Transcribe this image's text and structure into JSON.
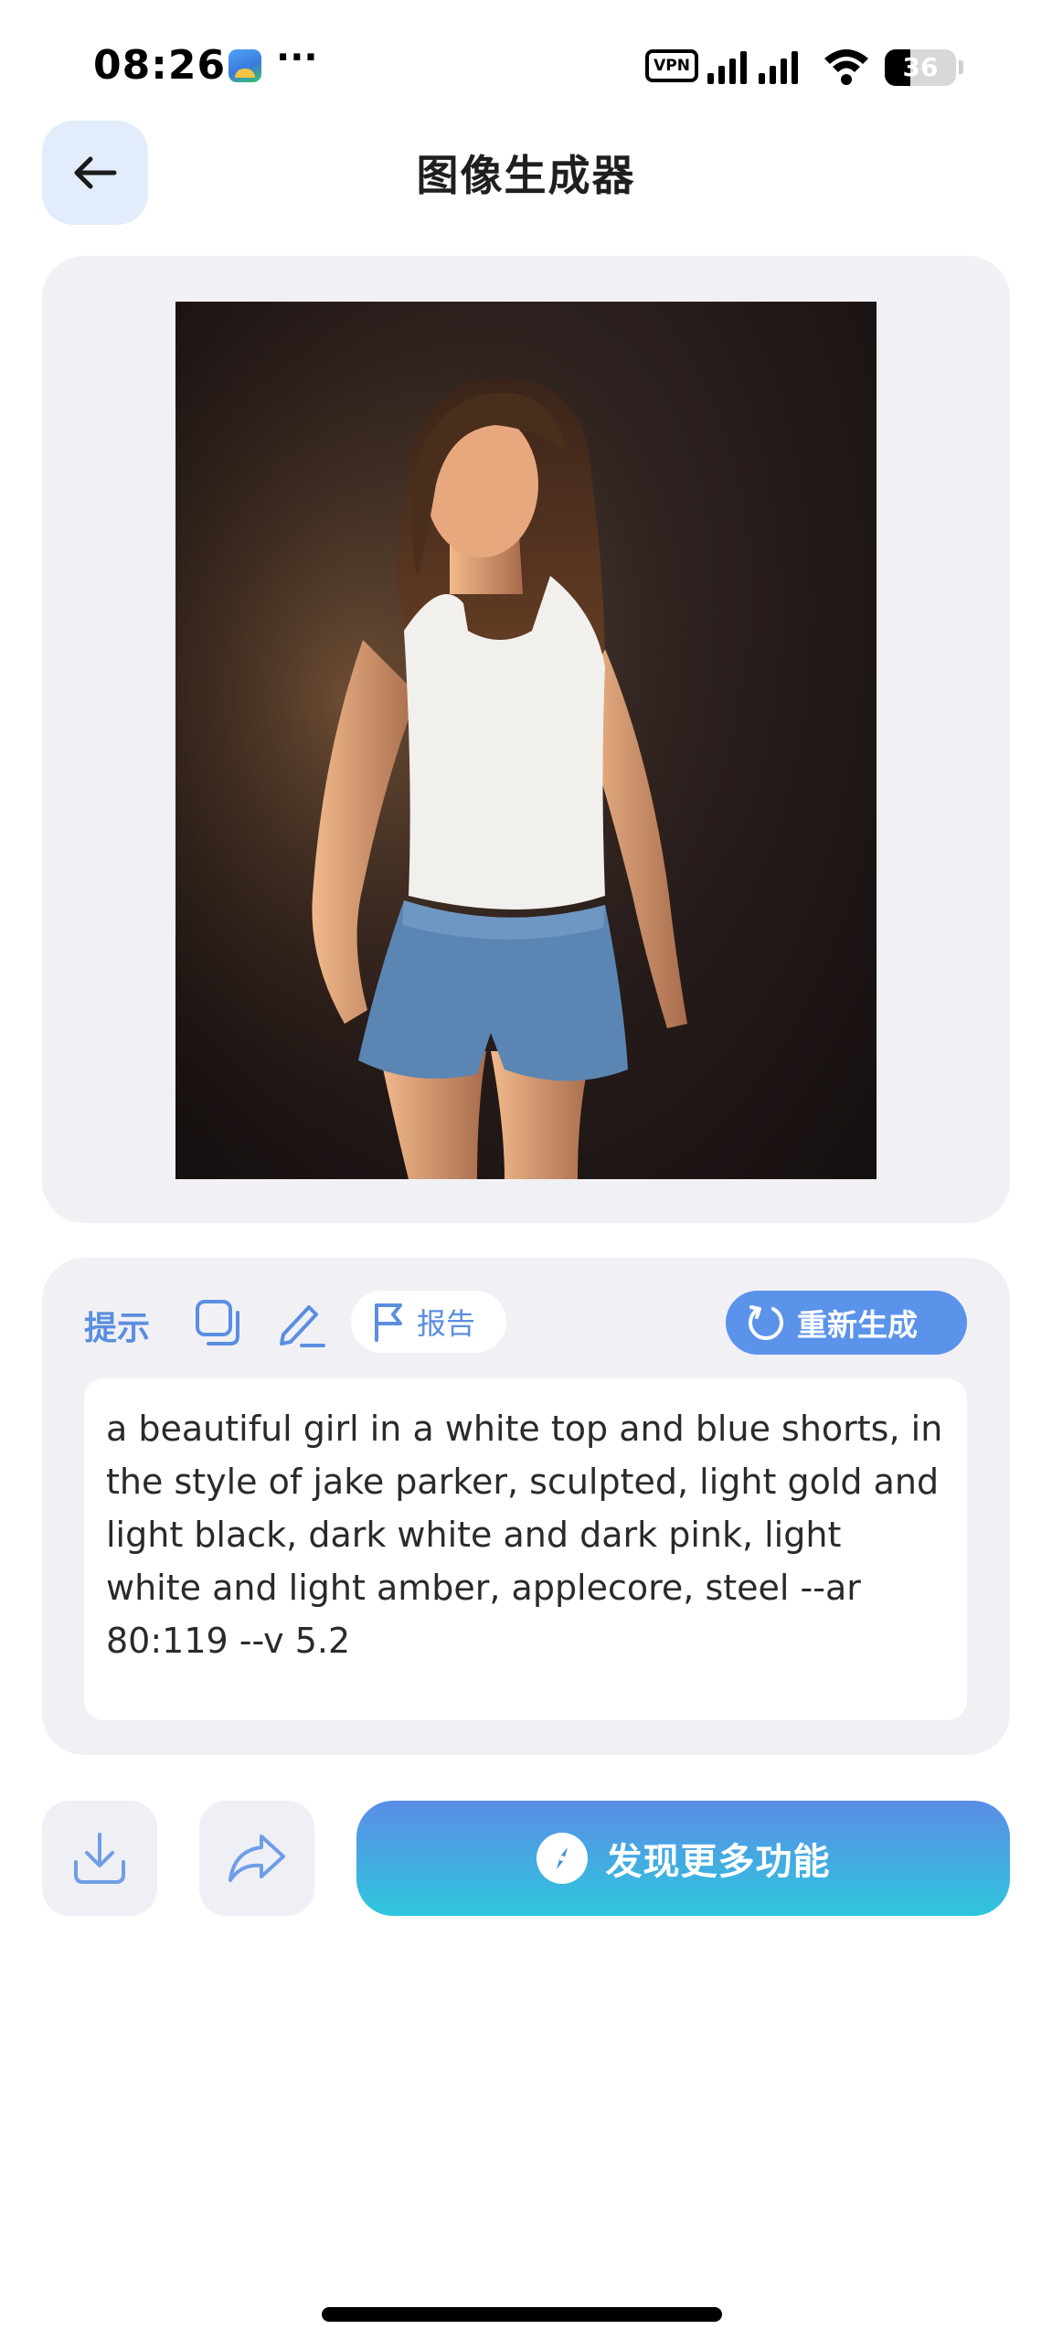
{
  "status_bar": {
    "time": "08:26",
    "more": "···",
    "vpn": "VPN",
    "battery": "36"
  },
  "header": {
    "title": "图像生成器"
  },
  "image": {
    "icon": "generated-portrait-image"
  },
  "prompt": {
    "label": "提示",
    "report_label": "报告",
    "regenerate_label": "重新生成",
    "text": "a beautiful girl in a white top and blue shorts, in the style of jake parker, sculpted, light gold and light black, dark white and dark pink, light white and light amber, applecore, steel --ar 80:119 --v 5.2"
  },
  "actions": {
    "discover_label": "发现更多功能"
  },
  "colors": {
    "accent": "#5b8ee0",
    "card_bg": "#f1f1f5",
    "gradient_top": "#5b8de6",
    "gradient_bottom": "#2ec6dd"
  }
}
